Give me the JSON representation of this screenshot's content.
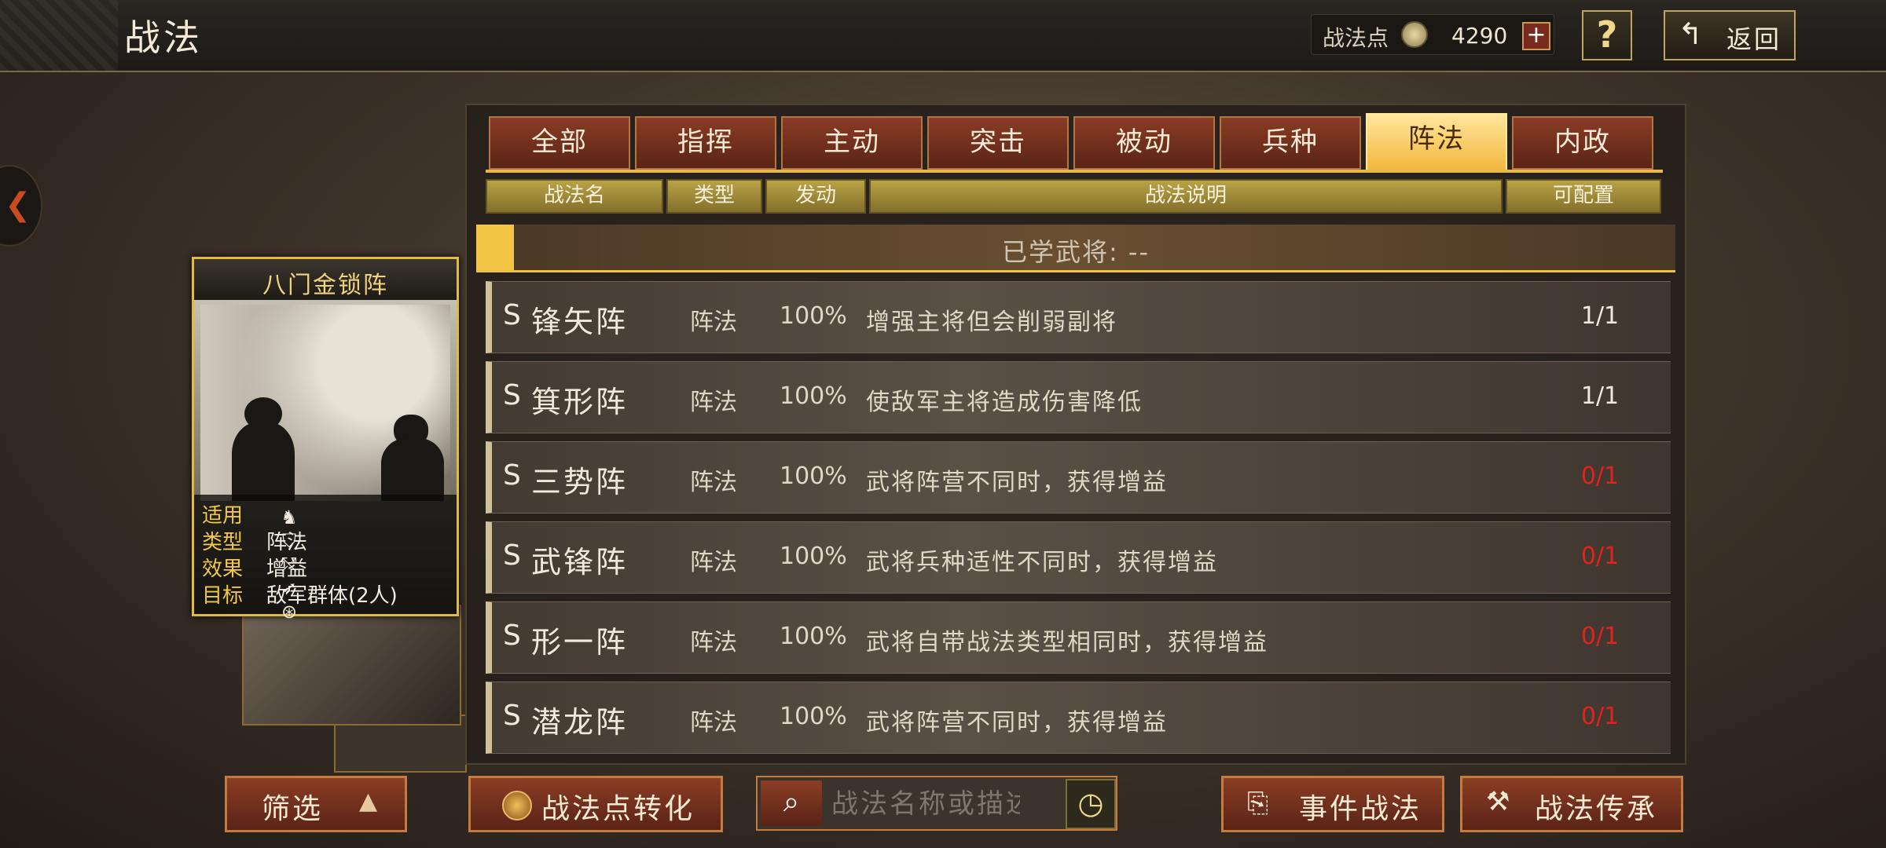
{
  "header": {
    "title": "战法",
    "points_label": "战法点",
    "points_value": "4290",
    "plus_label": "+",
    "help_label": "?",
    "back_label": "返回"
  },
  "card": {
    "title": "八门金锁阵",
    "rows": [
      {
        "key": "适用",
        "value": ""
      },
      {
        "key": "类型",
        "value": "阵法"
      },
      {
        "key": "效果",
        "value": "增益"
      },
      {
        "key": "目标",
        "value": "敌军群体(2人)"
      }
    ],
    "arms_icons": [
      "cavalry-icon",
      "shield-icon",
      "bow-icon",
      "spear-icon",
      "wheel-icon"
    ]
  },
  "tabs": [
    {
      "label": "全部",
      "active": false
    },
    {
      "label": "指挥",
      "active": false
    },
    {
      "label": "主动",
      "active": false
    },
    {
      "label": "突击",
      "active": false
    },
    {
      "label": "被动",
      "active": false
    },
    {
      "label": "兵种",
      "active": false
    },
    {
      "label": "阵法",
      "active": true
    },
    {
      "label": "内政",
      "active": false
    }
  ],
  "columns": [
    "战法名",
    "类型",
    "发动",
    "战法说明",
    "可配置"
  ],
  "learned_generals": "已学武将: --",
  "tactics": [
    {
      "grade": "S",
      "name": "锋矢阵",
      "type": "阵法",
      "rate": "100%",
      "desc": "增强主将但会削弱副将",
      "slots": "1/1",
      "slots_color": "#f1eadc"
    },
    {
      "grade": "S",
      "name": "箕形阵",
      "type": "阵法",
      "rate": "100%",
      "desc": "使敌军主将造成伤害降低",
      "slots": "1/1",
      "slots_color": "#f1eadc"
    },
    {
      "grade": "S",
      "name": "三势阵",
      "type": "阵法",
      "rate": "100%",
      "desc": "武将阵营不同时，获得增益",
      "slots": "0/1",
      "slots_color": "#e0231b"
    },
    {
      "grade": "S",
      "name": "武锋阵",
      "type": "阵法",
      "rate": "100%",
      "desc": "武将兵种适性不同时，获得增益",
      "slots": "0/1",
      "slots_color": "#e0231b"
    },
    {
      "grade": "S",
      "name": "形一阵",
      "type": "阵法",
      "rate": "100%",
      "desc": "武将自带战法类型相同时，获得增益",
      "slots": "0/1",
      "slots_color": "#e0231b"
    },
    {
      "grade": "S",
      "name": "潜龙阵",
      "type": "阵法",
      "rate": "100%",
      "desc": "武将阵营不同时，获得增益",
      "slots": "0/1",
      "slots_color": "#e0231b"
    }
  ],
  "bottom": {
    "filter_label": "筛选",
    "convert_label": "战法点转化",
    "search_placeholder": "战法名称或描述",
    "event_label": "事件战法",
    "inherit_label": "战法传承"
  }
}
